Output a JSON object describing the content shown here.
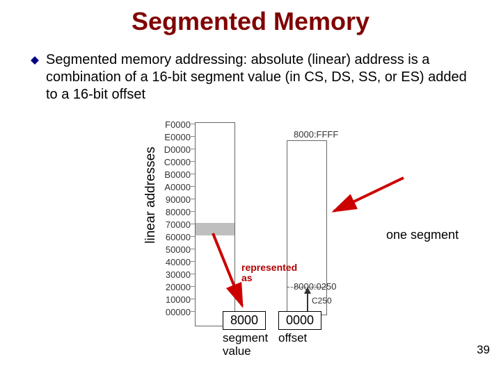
{
  "title": "Segmented Memory",
  "bullet": "Segmented memory addressing: absolute (linear) address is a combination of a 16-bit segment value (in CS, DS, SS, or ES) added to a 16-bit offset",
  "axis_label": "linear addresses",
  "one_segment_label": "one segment",
  "represented_label": "represented\nas",
  "box_segment_value": "8000",
  "box_offset_value": "0000",
  "label_segment": "segment value",
  "label_offset": "offset",
  "seg_top_label": "8000:FFFF",
  "seg_mid_label": "8000:0250",
  "seg_code_label": "C250",
  "ticks": [
    "F0000",
    "E0000",
    "D0000",
    "C0000",
    "B0000",
    "A0000",
    "90000",
    "80000",
    "70000",
    "60000",
    "50000",
    "40000",
    "30000",
    "20000",
    "10000",
    "00000"
  ],
  "page_number": "39",
  "chart_data": {
    "type": "diagram-memory-segment",
    "linear_address_ticks_hex": [
      "00000",
      "10000",
      "20000",
      "30000",
      "40000",
      "50000",
      "60000",
      "70000",
      "80000",
      "90000",
      "A0000",
      "B0000",
      "C0000",
      "D0000",
      "E0000",
      "F0000"
    ],
    "highlighted_segment_base_hex": "80000",
    "segment_window": {
      "top_label": "8000:FFFF",
      "marked_label": "8000:0250",
      "linear_of_marked_hex": "C250"
    },
    "example_segment_register": "8000",
    "example_offset": "0000"
  }
}
